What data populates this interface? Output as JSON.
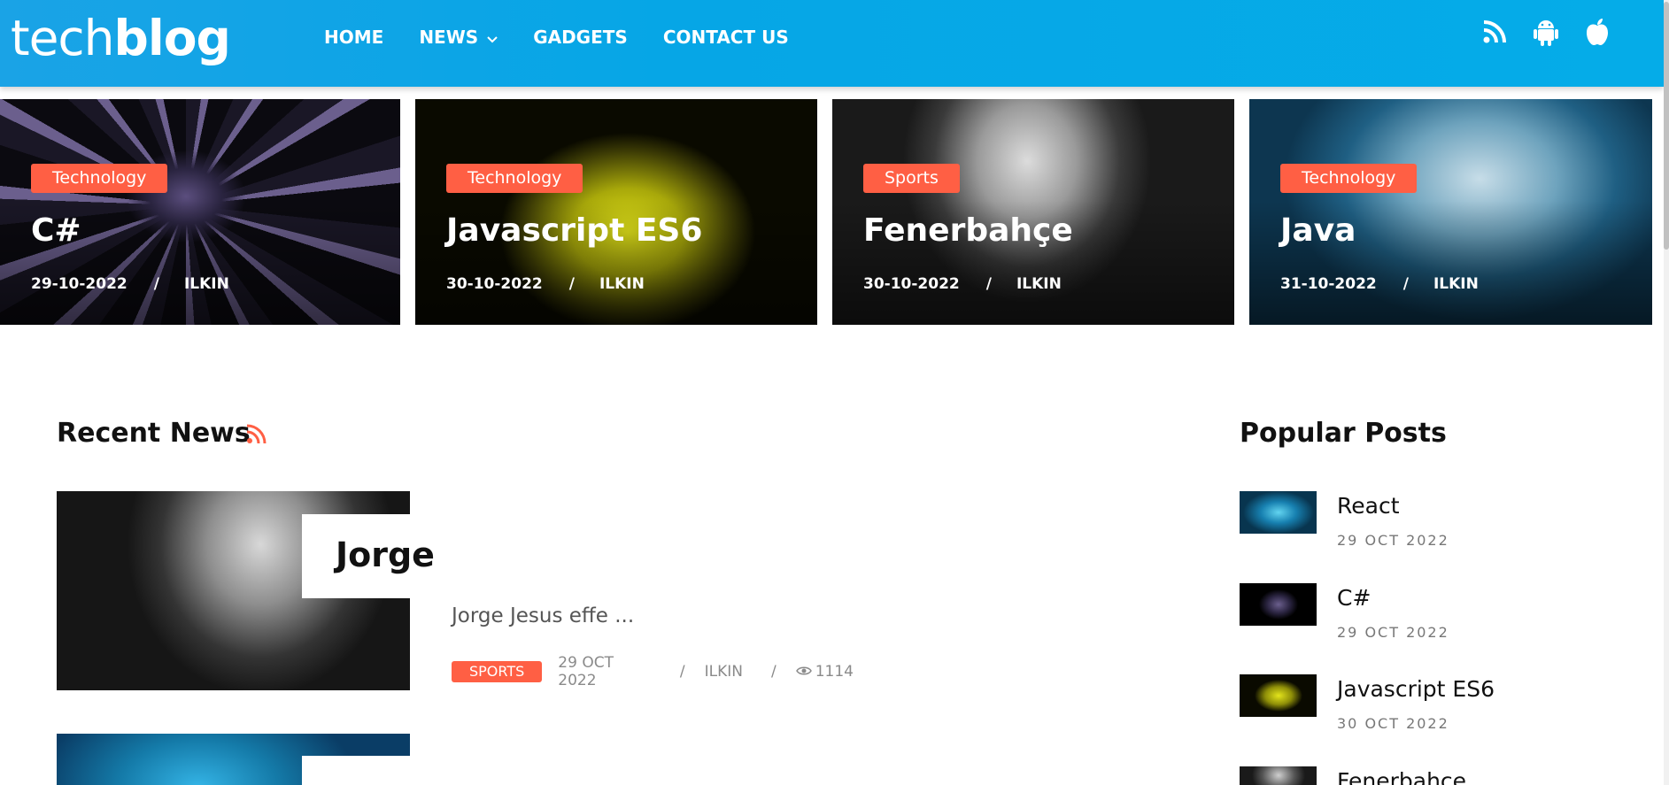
{
  "header": {
    "logo_part1": "tech",
    "logo_part2": "blog",
    "nav": [
      {
        "label": "HOME"
      },
      {
        "label": "NEWS"
      },
      {
        "label": "GADGETS"
      },
      {
        "label": "CONTACT US"
      }
    ],
    "icons": [
      "rss-icon",
      "android-icon",
      "apple-icon"
    ],
    "accent": "#06a6e6"
  },
  "slider": [
    {
      "category": "Technology",
      "title": "C#",
      "date": "29-10-2022",
      "separator": "/",
      "author": "ILKIN"
    },
    {
      "category": "Technology",
      "title": "Javascript ES6",
      "date": "30-10-2022",
      "separator": "/",
      "author": "ILKIN"
    },
    {
      "category": "Sports",
      "title": "Fenerbahçe",
      "date": "30-10-2022",
      "separator": "/",
      "author": "ILKIN"
    },
    {
      "category": "Technology",
      "title": "Java",
      "date": "31-10-2022",
      "separator": "/",
      "author": "ILKIN"
    }
  ],
  "recent": {
    "heading": "Recent News",
    "items": [
      {
        "title": "Jorge",
        "excerpt": "Jorge Jesus effe ...",
        "category": "SPORTS",
        "date": "29 OCT 2022",
        "separator": "/",
        "author": "ILKIN",
        "views": "1114"
      }
    ]
  },
  "popular": {
    "heading": "Popular Posts",
    "items": [
      {
        "title": "React",
        "date": "29 OCT 2022"
      },
      {
        "title": "C#",
        "date": "29 OCT 2022"
      },
      {
        "title": "Javascript ES6",
        "date": "30 OCT 2022"
      },
      {
        "title": "Fenerbahce",
        "date": ""
      }
    ]
  },
  "colors": {
    "badge": "#ff5f44",
    "header": "#06a6e6"
  }
}
